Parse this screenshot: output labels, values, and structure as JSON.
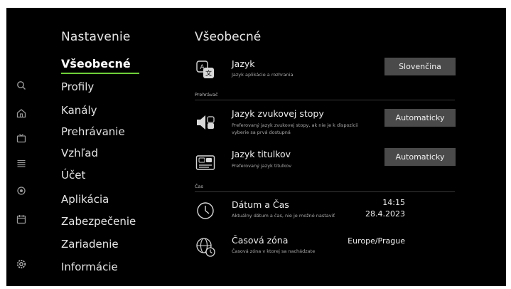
{
  "rail": {
    "icons": [
      "search-icon",
      "home-icon",
      "tv-icon",
      "list-icon",
      "record-icon",
      "calendar-icon",
      "settings-icon"
    ]
  },
  "nav": {
    "title": "Nastavenie",
    "items": [
      {
        "label": "Všeobecné",
        "active": true
      },
      {
        "label": "Profily"
      },
      {
        "label": "Kanály"
      },
      {
        "label": "Prehrávanie"
      },
      {
        "label": "Vzhľad"
      },
      {
        "label": "Účet"
      },
      {
        "label": "Aplikácia"
      },
      {
        "label": "Zabezpečenie"
      },
      {
        "label": "Zariadenie"
      },
      {
        "label": "Informácie"
      }
    ],
    "accent": "#6fcf3a"
  },
  "main": {
    "title": "Všeobecné",
    "language": {
      "title": "Jazyk",
      "desc": "Jazyk aplikácie a rozhrania",
      "value": "Slovenčina"
    },
    "section_player": "Prehrávač",
    "audio": {
      "title": "Jazyk zvukovej stopy",
      "desc": "Preferovaný jazyk zvukovej stopy, ak nie je k dispozícii vyberie sa prvá dostupná",
      "value": "Automaticky"
    },
    "subtitles": {
      "title": "Jazyk titulkov",
      "desc": "Preferovaný jazyk titulkov",
      "value": "Automaticky"
    },
    "section_time": "Čas",
    "datetime": {
      "title": "Dátum a Čas",
      "desc": "Aktuálny dátum a čas, nie je možné nastaviť",
      "time": "14:15",
      "date": "28.4.2023"
    },
    "timezone": {
      "title": "Časová zóna",
      "desc": "Časová zóna v ktorej sa nachádzate",
      "value": "Europe/Prague"
    }
  }
}
